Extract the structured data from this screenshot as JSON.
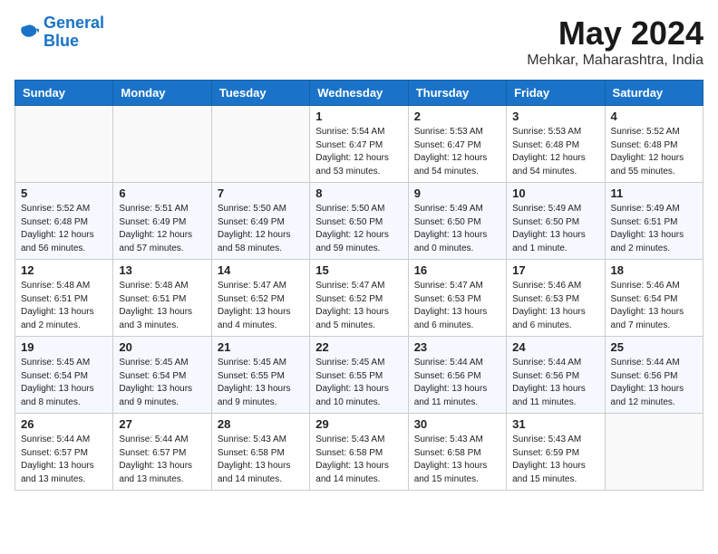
{
  "logo": {
    "line1": "General",
    "line2": "Blue"
  },
  "title": "May 2024",
  "location": "Mehkar, Maharashtra, India",
  "days_of_week": [
    "Sunday",
    "Monday",
    "Tuesday",
    "Wednesday",
    "Thursday",
    "Friday",
    "Saturday"
  ],
  "weeks": [
    [
      {
        "day": "",
        "info": ""
      },
      {
        "day": "",
        "info": ""
      },
      {
        "day": "",
        "info": ""
      },
      {
        "day": "1",
        "info": "Sunrise: 5:54 AM\nSunset: 6:47 PM\nDaylight: 12 hours\nand 53 minutes."
      },
      {
        "day": "2",
        "info": "Sunrise: 5:53 AM\nSunset: 6:47 PM\nDaylight: 12 hours\nand 54 minutes."
      },
      {
        "day": "3",
        "info": "Sunrise: 5:53 AM\nSunset: 6:48 PM\nDaylight: 12 hours\nand 54 minutes."
      },
      {
        "day": "4",
        "info": "Sunrise: 5:52 AM\nSunset: 6:48 PM\nDaylight: 12 hours\nand 55 minutes."
      }
    ],
    [
      {
        "day": "5",
        "info": "Sunrise: 5:52 AM\nSunset: 6:48 PM\nDaylight: 12 hours\nand 56 minutes."
      },
      {
        "day": "6",
        "info": "Sunrise: 5:51 AM\nSunset: 6:49 PM\nDaylight: 12 hours\nand 57 minutes."
      },
      {
        "day": "7",
        "info": "Sunrise: 5:50 AM\nSunset: 6:49 PM\nDaylight: 12 hours\nand 58 minutes."
      },
      {
        "day": "8",
        "info": "Sunrise: 5:50 AM\nSunset: 6:50 PM\nDaylight: 12 hours\nand 59 minutes."
      },
      {
        "day": "9",
        "info": "Sunrise: 5:49 AM\nSunset: 6:50 PM\nDaylight: 13 hours\nand 0 minutes."
      },
      {
        "day": "10",
        "info": "Sunrise: 5:49 AM\nSunset: 6:50 PM\nDaylight: 13 hours\nand 1 minute."
      },
      {
        "day": "11",
        "info": "Sunrise: 5:49 AM\nSunset: 6:51 PM\nDaylight: 13 hours\nand 2 minutes."
      }
    ],
    [
      {
        "day": "12",
        "info": "Sunrise: 5:48 AM\nSunset: 6:51 PM\nDaylight: 13 hours\nand 2 minutes."
      },
      {
        "day": "13",
        "info": "Sunrise: 5:48 AM\nSunset: 6:51 PM\nDaylight: 13 hours\nand 3 minutes."
      },
      {
        "day": "14",
        "info": "Sunrise: 5:47 AM\nSunset: 6:52 PM\nDaylight: 13 hours\nand 4 minutes."
      },
      {
        "day": "15",
        "info": "Sunrise: 5:47 AM\nSunset: 6:52 PM\nDaylight: 13 hours\nand 5 minutes."
      },
      {
        "day": "16",
        "info": "Sunrise: 5:47 AM\nSunset: 6:53 PM\nDaylight: 13 hours\nand 6 minutes."
      },
      {
        "day": "17",
        "info": "Sunrise: 5:46 AM\nSunset: 6:53 PM\nDaylight: 13 hours\nand 6 minutes."
      },
      {
        "day": "18",
        "info": "Sunrise: 5:46 AM\nSunset: 6:54 PM\nDaylight: 13 hours\nand 7 minutes."
      }
    ],
    [
      {
        "day": "19",
        "info": "Sunrise: 5:45 AM\nSunset: 6:54 PM\nDaylight: 13 hours\nand 8 minutes."
      },
      {
        "day": "20",
        "info": "Sunrise: 5:45 AM\nSunset: 6:54 PM\nDaylight: 13 hours\nand 9 minutes."
      },
      {
        "day": "21",
        "info": "Sunrise: 5:45 AM\nSunset: 6:55 PM\nDaylight: 13 hours\nand 9 minutes."
      },
      {
        "day": "22",
        "info": "Sunrise: 5:45 AM\nSunset: 6:55 PM\nDaylight: 13 hours\nand 10 minutes."
      },
      {
        "day": "23",
        "info": "Sunrise: 5:44 AM\nSunset: 6:56 PM\nDaylight: 13 hours\nand 11 minutes."
      },
      {
        "day": "24",
        "info": "Sunrise: 5:44 AM\nSunset: 6:56 PM\nDaylight: 13 hours\nand 11 minutes."
      },
      {
        "day": "25",
        "info": "Sunrise: 5:44 AM\nSunset: 6:56 PM\nDaylight: 13 hours\nand 12 minutes."
      }
    ],
    [
      {
        "day": "26",
        "info": "Sunrise: 5:44 AM\nSunset: 6:57 PM\nDaylight: 13 hours\nand 13 minutes."
      },
      {
        "day": "27",
        "info": "Sunrise: 5:44 AM\nSunset: 6:57 PM\nDaylight: 13 hours\nand 13 minutes."
      },
      {
        "day": "28",
        "info": "Sunrise: 5:43 AM\nSunset: 6:58 PM\nDaylight: 13 hours\nand 14 minutes."
      },
      {
        "day": "29",
        "info": "Sunrise: 5:43 AM\nSunset: 6:58 PM\nDaylight: 13 hours\nand 14 minutes."
      },
      {
        "day": "30",
        "info": "Sunrise: 5:43 AM\nSunset: 6:58 PM\nDaylight: 13 hours\nand 15 minutes."
      },
      {
        "day": "31",
        "info": "Sunrise: 5:43 AM\nSunset: 6:59 PM\nDaylight: 13 hours\nand 15 minutes."
      },
      {
        "day": "",
        "info": ""
      }
    ]
  ]
}
